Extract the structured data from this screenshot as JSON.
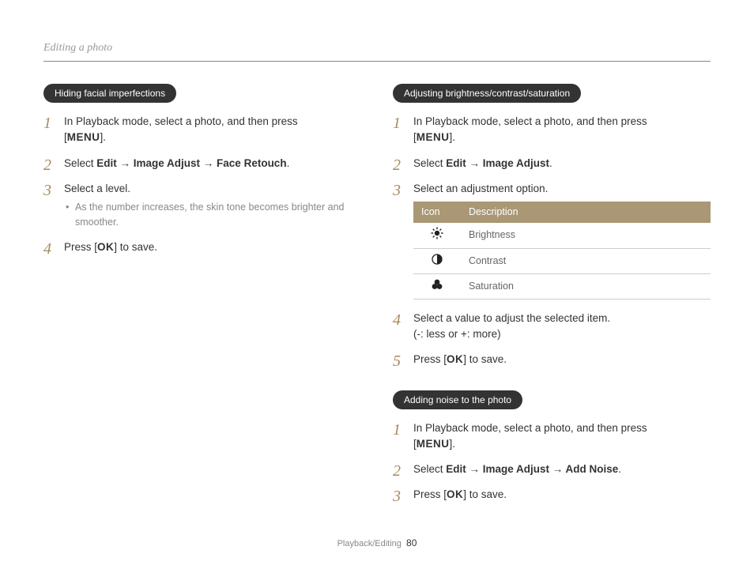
{
  "header": "Editing a photo",
  "left": {
    "pill": "Hiding facial imperfections",
    "step1a": "In Playback mode, select a photo, and then press",
    "step1b_open": "[",
    "step1b_menu": "MENU",
    "step1b_close": "].",
    "step2_pre": "Select ",
    "step2_bold": "Edit → Image Adjust → Face Retouch",
    "step2_post": ".",
    "step3": "Select a level.",
    "step3_note": "As the number increases, the skin tone becomes brighter and smoother.",
    "step4_pre": "Press [",
    "step4_ok": "OK",
    "step4_post": "] to save."
  },
  "right1": {
    "pill": "Adjusting brightness/contrast/saturation",
    "step1a": "In Playback mode, select a photo, and then press",
    "step1b_open": "[",
    "step1b_menu": "MENU",
    "step1b_close": "].",
    "step2_pre": "Select ",
    "step2_bold": "Edit → Image Adjust",
    "step2_post": ".",
    "step3": "Select an adjustment option.",
    "table": {
      "h1": "Icon",
      "h2": "Description",
      "r1": "Brightness",
      "r2": "Contrast",
      "r3": "Saturation"
    },
    "step4a": "Select a value to adjust the selected item.",
    "step4b": "(-: less or +: more)",
    "step5_pre": "Press [",
    "step5_ok": "OK",
    "step5_post": "] to save."
  },
  "right2": {
    "pill": "Adding noise to the photo",
    "step1a": "In Playback mode, select a photo, and then press",
    "step1b_open": "[",
    "step1b_menu": "MENU",
    "step1b_close": "].",
    "step2_pre": "Select ",
    "step2_bold": "Edit → Image Adjust → Add Noise",
    "step2_post": ".",
    "step3_pre": "Press [",
    "step3_ok": "OK",
    "step3_post": "] to save."
  },
  "footer": {
    "section": "Playback/Editing",
    "page": "80"
  }
}
